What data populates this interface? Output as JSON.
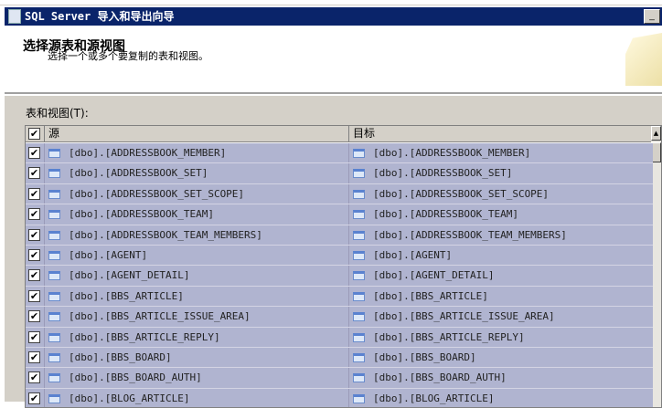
{
  "window": {
    "title": "SQL Server 导入和导出向导",
    "minimize": "_"
  },
  "header": {
    "title": "选择源表和源视图",
    "subtitle": "选择一个或多个要复制的表和视图。"
  },
  "tables_label": "表和视图(T):",
  "columns": {
    "source": "源",
    "destination": "目标",
    "scroll_up": "▲"
  },
  "rows": [
    {
      "checked": true,
      "source": "[dbo].[ADDRESSBOOK_MEMBER]",
      "destination": "[dbo].[ADDRESSBOOK_MEMBER]"
    },
    {
      "checked": true,
      "source": "[dbo].[ADDRESSBOOK_SET]",
      "destination": "[dbo].[ADDRESSBOOK_SET]"
    },
    {
      "checked": true,
      "source": "[dbo].[ADDRESSBOOK_SET_SCOPE]",
      "destination": "[dbo].[ADDRESSBOOK_SET_SCOPE]"
    },
    {
      "checked": true,
      "source": "[dbo].[ADDRESSBOOK_TEAM]",
      "destination": "[dbo].[ADDRESSBOOK_TEAM]"
    },
    {
      "checked": true,
      "source": "[dbo].[ADDRESSBOOK_TEAM_MEMBERS]",
      "destination": "[dbo].[ADDRESSBOOK_TEAM_MEMBERS]"
    },
    {
      "checked": true,
      "source": "[dbo].[AGENT]",
      "destination": "[dbo].[AGENT]"
    },
    {
      "checked": true,
      "source": "[dbo].[AGENT_DETAIL]",
      "destination": "[dbo].[AGENT_DETAIL]"
    },
    {
      "checked": true,
      "source": "[dbo].[BBS_ARTICLE]",
      "destination": "[dbo].[BBS_ARTICLE]"
    },
    {
      "checked": true,
      "source": "[dbo].[BBS_ARTICLE_ISSUE_AREA]",
      "destination": "[dbo].[BBS_ARTICLE_ISSUE_AREA]"
    },
    {
      "checked": true,
      "source": "[dbo].[BBS_ARTICLE_REPLY]",
      "destination": "[dbo].[BBS_ARTICLE_REPLY]"
    },
    {
      "checked": true,
      "source": "[dbo].[BBS_BOARD]",
      "destination": "[dbo].[BBS_BOARD]"
    },
    {
      "checked": true,
      "source": "[dbo].[BBS_BOARD_AUTH]",
      "destination": "[dbo].[BBS_BOARD_AUTH]"
    },
    {
      "checked": true,
      "source": "[dbo].[BLOG_ARTICLE]",
      "destination": "[dbo].[BLOG_ARTICLE]"
    }
  ]
}
